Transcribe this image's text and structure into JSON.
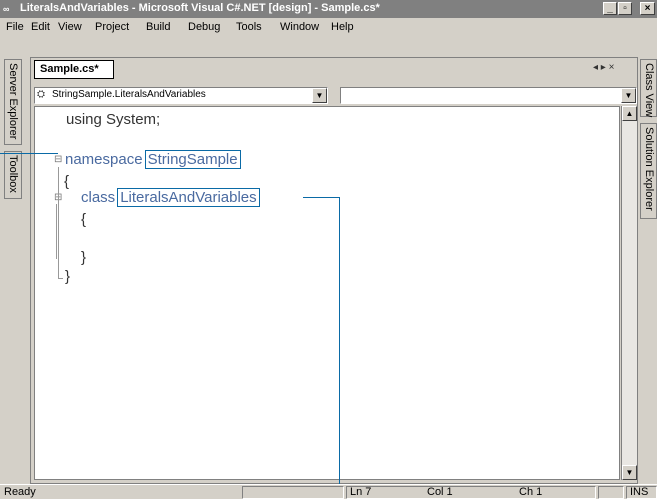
{
  "window": {
    "title": "LiteralsAndVariables - Microsoft Visual C#.NET [design] - Sample.cs*",
    "app_icon": "vs-net-icon",
    "controls": {
      "minimize": "_",
      "maximize": "▫",
      "close": "×"
    }
  },
  "menu": [
    "File",
    "Edit",
    "View",
    "Project",
    "Build",
    "Debug",
    "Tools",
    "Window",
    "Help"
  ],
  "left_tool_tabs": [
    "Server Explorer",
    "Toolbox"
  ],
  "right_tool_tabs": [
    "Class View",
    "Solution Explorer"
  ],
  "editor": {
    "tab_label": "Sample.cs*",
    "tab_nav": "◂ ▸ ×",
    "type_dropdown": "StringSample.LiteralsAndVariables",
    "member_dropdown": ""
  },
  "code": {
    "line1": "using System;",
    "ns_keyword": "namespace",
    "ns_name": "StringSample",
    "open_brace1": "{",
    "class_keyword": "class",
    "class_name": "LiteralsAndVariables",
    "open_brace2": "{",
    "close_brace2": "}",
    "close_brace1": "}"
  },
  "status": {
    "text": "Ready",
    "ln": "Ln 7",
    "col": "Col 1",
    "ch": "Ch 1",
    "mode": "INS"
  }
}
